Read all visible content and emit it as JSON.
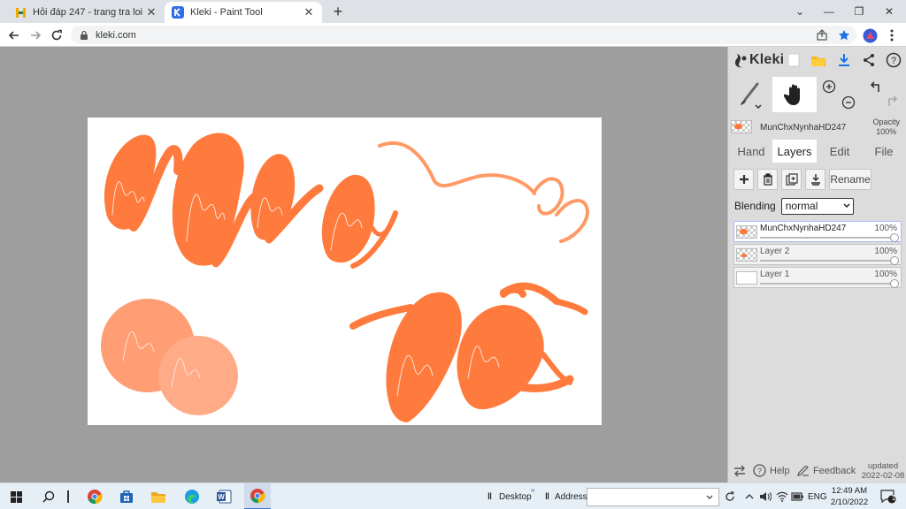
{
  "browser": {
    "tabs": [
      {
        "title": "Hỏi đáp 247 - trang tra loi",
        "favicon": "h247-icon"
      },
      {
        "title": "Kleki - Paint Tool",
        "favicon": "kleki-icon"
      }
    ],
    "new_tab": "+",
    "url": "kleki.com"
  },
  "kleki": {
    "brand": "Kleki",
    "current_layer": {
      "name": "MunChxNynhaHD247",
      "opacity_label": "Opacity",
      "opacity": "100%"
    },
    "panel_tabs": [
      "Hand",
      "Layers",
      "Edit",
      "File"
    ],
    "actions": {
      "rename": "Rename"
    },
    "blending": {
      "label": "Blending",
      "value": "normal"
    },
    "layers": [
      {
        "name": "MunChxNynhaHD247",
        "opacity": "100%",
        "selected": true
      },
      {
        "name": "Layer 2",
        "opacity": "100%",
        "selected": false
      },
      {
        "name": "Layer 1",
        "opacity": "100%",
        "selected": false
      }
    ],
    "footer": {
      "help": "Help",
      "feedback": "Feedback",
      "updated": "updated",
      "date": "2022-02-08"
    },
    "colors": {
      "accent": "#ff7a3d",
      "light": "#ffa27d",
      "primary": "#1a73e8"
    }
  },
  "taskbar": {
    "desktop": "Desktop",
    "address": "Address",
    "language": "ENG",
    "time": "12:49 AM",
    "date": "2/10/2022",
    "notifications": "1"
  }
}
